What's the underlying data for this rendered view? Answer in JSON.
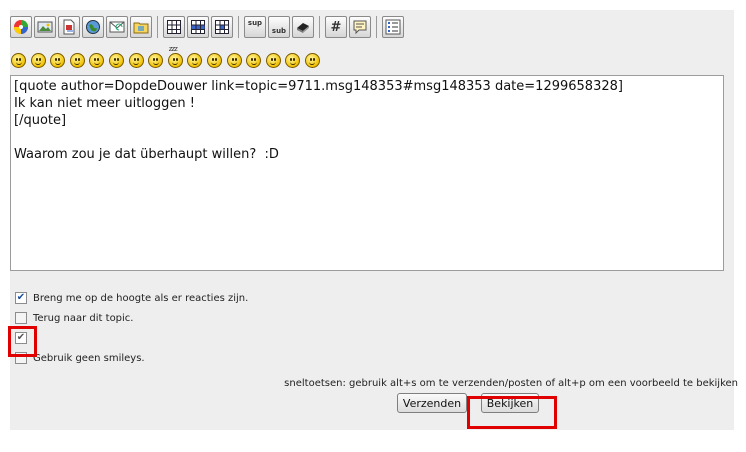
{
  "toolbar": {
    "buttons": [
      {
        "name": "color-wheel-icon"
      },
      {
        "name": "image-icon"
      },
      {
        "name": "attachment-icon"
      },
      {
        "name": "globe-link-icon"
      },
      {
        "name": "email-icon"
      },
      {
        "name": "folder-ftp-icon"
      },
      {
        "name": "table-icon"
      },
      {
        "name": "table-row-icon"
      },
      {
        "name": "table-cell-icon"
      },
      {
        "name": "superscript-icon",
        "text": "sup"
      },
      {
        "name": "subscript-icon",
        "text": "sub"
      },
      {
        "name": "shadow-icon"
      },
      {
        "name": "code-icon",
        "text": "#"
      },
      {
        "name": "quote-icon"
      },
      {
        "name": "list-icon"
      }
    ]
  },
  "smileys": {
    "count": 16,
    "sleepy_text": "zzz"
  },
  "editor": {
    "text": "[quote author=DopdeDouwer link=topic=9711.msg148353#msg148353 date=1299658328]\nIk kan niet meer uitloggen !\n[/quote]\n\nWaarom zou je dat überhaupt willen?  :D"
  },
  "options": [
    {
      "label": "Breng me op de hoogte als er reacties zijn.",
      "checked": true
    },
    {
      "label": "Terug naar dit topic.",
      "checked": false
    },
    {
      "label": "",
      "checked": true
    },
    {
      "label": "Gebruik geen smileys.",
      "checked": false
    }
  ],
  "hotkeys_text": "sneltoetsen: gebruik alt+s om te verzenden/posten of alt+p om een voorbeeld te bekijken",
  "buttons": {
    "send": "Verzenden",
    "preview": "Bekijken"
  },
  "colors": {
    "highlight": "#e00000",
    "check": "#1a4ca0"
  }
}
